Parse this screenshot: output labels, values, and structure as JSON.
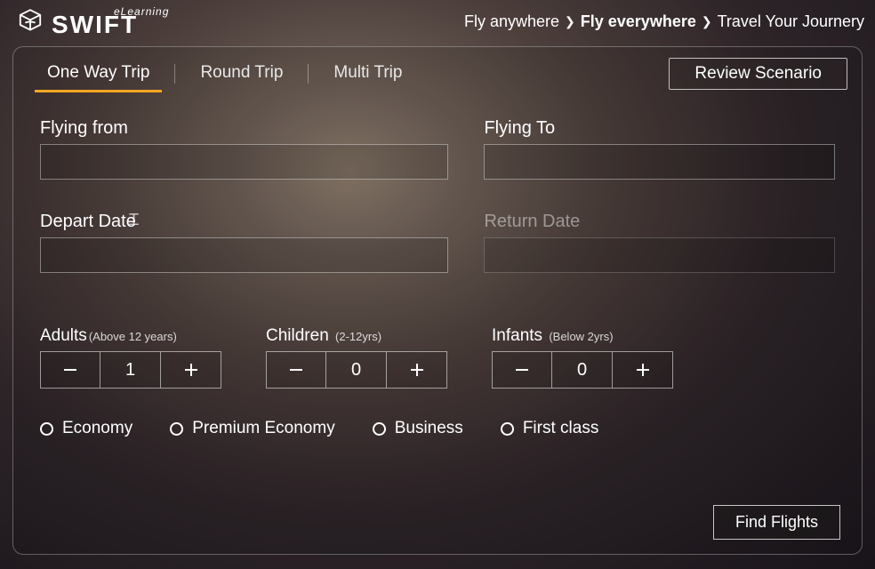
{
  "logo": {
    "elearning": "eLearning",
    "brand": "SWIFT"
  },
  "headerNav": {
    "item1": "Fly anywhere",
    "item2": "Fly everywhere",
    "item3": "Travel Your Journery"
  },
  "tabs": {
    "oneWay": "One Way Trip",
    "round": "Round Trip",
    "multi": "Multi Trip"
  },
  "reviewButton": "Review Scenario",
  "fields": {
    "from": {
      "label": "Flying from",
      "value": ""
    },
    "to": {
      "label": "Flying To",
      "value": ""
    },
    "depart": {
      "label": "Depart Date",
      "value": ""
    },
    "return": {
      "label": "Return Date",
      "value": ""
    }
  },
  "pax": {
    "adults": {
      "label": "Adults",
      "hint": "(Above 12 years)",
      "value": "1"
    },
    "children": {
      "label": "Children",
      "hint": "(2-12yrs)",
      "value": "0"
    },
    "infants": {
      "label": "Infants",
      "hint": "(Below 2yrs)",
      "value": "0"
    }
  },
  "classes": {
    "economy": "Economy",
    "premium": "Premium Economy",
    "business": "Business",
    "first": "First class"
  },
  "findButton": "Find Flights"
}
